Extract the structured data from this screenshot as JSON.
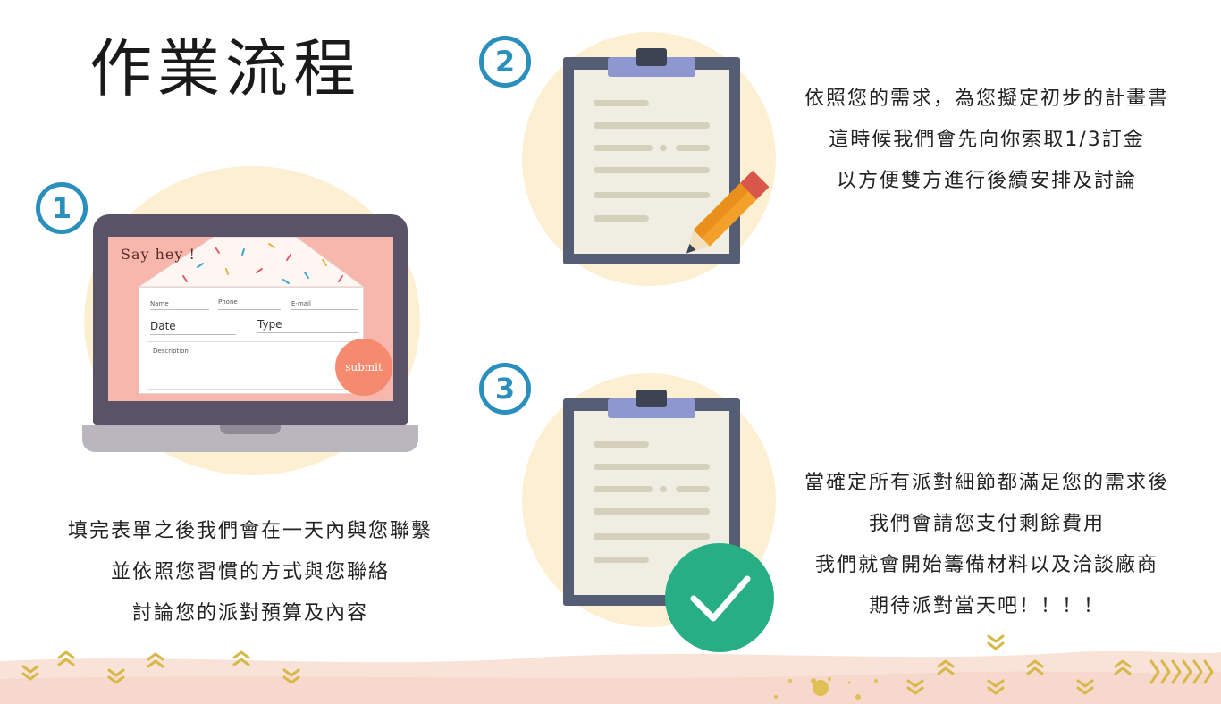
{
  "title": "作業流程",
  "steps": [
    {
      "number": "1",
      "lines": [
        "填完表單之後我們會在一天內與您聯繫",
        "並依照您習慣的方式與您聯絡",
        "討論您的派對預算及內容"
      ]
    },
    {
      "number": "2",
      "lines": [
        "依照您的需求，為您擬定初步的計畫書",
        "這時候我們會先向你索取1/3訂金",
        "以方便雙方進行後續安排及討論"
      ]
    },
    {
      "number": "3",
      "lines": [
        "當確定所有派對細節都滿足您的需求後",
        "我們會請您支付剩餘費用",
        "我們就會開始籌備材料以及洽談廠商",
        "期待派對當天吧！！！！"
      ]
    }
  ],
  "form": {
    "header": "Say hey !",
    "name_label": "Name",
    "phone_label": "Phone",
    "email_label": "E-mail",
    "date_label": "Date",
    "type_label": "Type",
    "description_label": "Description",
    "submit_label": "submit"
  },
  "colors": {
    "badge": "#2a8fbd",
    "circle_bg": "#fdf0d2",
    "check": "#27ae84",
    "chevron": "#d8b84a",
    "footer_wash": "#f6d9cc"
  },
  "icons": {
    "laptop": "laptop-icon",
    "clipboard_pencil": "clipboard-pencil-icon",
    "clipboard_check": "clipboard-check-icon",
    "check": "checkmark-icon"
  }
}
